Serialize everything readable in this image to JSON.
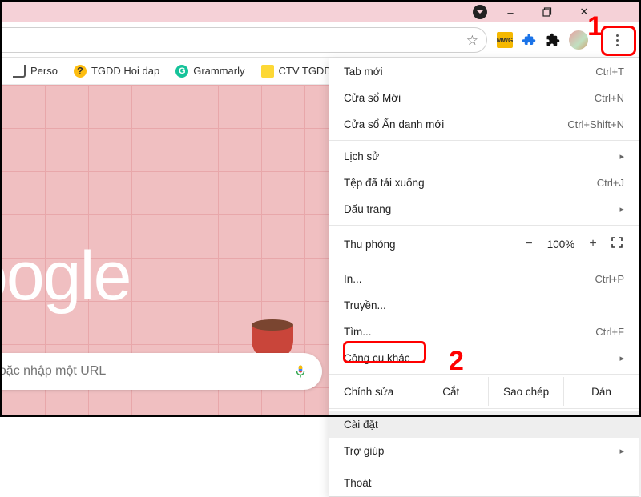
{
  "window_controls": {
    "minimize": "–",
    "maximize": "▢",
    "close": "✕"
  },
  "bookmarks": [
    {
      "label": "Perso",
      "icon": "folder"
    },
    {
      "label": "TGDD Hoi dap",
      "icon": "hoi"
    },
    {
      "label": "Grammarly",
      "icon": "gram"
    },
    {
      "label": "CTV TGDD",
      "icon": "ctv"
    }
  ],
  "search_placeholder": "hoặc nhập một URL",
  "logo_text": "oogle",
  "menu": {
    "new_tab": {
      "label": "Tab mới",
      "shortcut": "Ctrl+T"
    },
    "new_window": {
      "label": "Cửa sổ Mới",
      "shortcut": "Ctrl+N"
    },
    "incognito": {
      "label": "Cửa sổ Ẩn danh mới",
      "shortcut": "Ctrl+Shift+N"
    },
    "history": {
      "label": "Lịch sử"
    },
    "downloads": {
      "label": "Tệp đã tải xuống",
      "shortcut": "Ctrl+J"
    },
    "bookmarks": {
      "label": "Dấu trang"
    },
    "zoom": {
      "label": "Thu phóng",
      "value": "100%"
    },
    "print": {
      "label": "In...",
      "shortcut": "Ctrl+P"
    },
    "cast": {
      "label": "Truyền..."
    },
    "find": {
      "label": "Tìm...",
      "shortcut": "Ctrl+F"
    },
    "more_tools": {
      "label": "Công cụ khác"
    },
    "edit": {
      "label": "Chỉnh sửa",
      "cut": "Cắt",
      "copy": "Sao chép",
      "paste": "Dán"
    },
    "settings": {
      "label": "Cài đặt"
    },
    "help": {
      "label": "Trợ giúp"
    },
    "exit": {
      "label": "Thoát"
    }
  },
  "annotations": {
    "step1": "1",
    "step2": "2"
  }
}
